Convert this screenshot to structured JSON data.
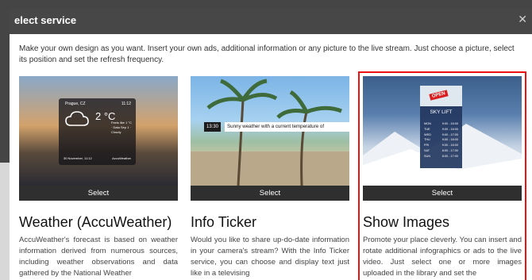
{
  "modal": {
    "title": "elect service",
    "close_icon": "close-icon",
    "intro": "Make your own design as you want. Insert your own ads, additional information or any picture to the live stream. Just choose a picture, select its position and set the refresh frequency."
  },
  "cards": [
    {
      "select_label": "Select",
      "title": "Weather (AccuWeather)",
      "description": "AccuWeather's forecast is based on weather information derived from numerous sources, including weather observations and data gathered by the National Weather",
      "preview": {
        "location": "Prague, CZ",
        "time": "11:12",
        "temperature": "2 °C",
        "details": "Feels like 1 °C · Data Sep 1 · Cloudy",
        "date": "30 November, 11:12",
        "brand": "AccuWeather"
      }
    },
    {
      "select_label": "Select",
      "title": "Info Ticker",
      "description": "Would you like to share up-do-date information in your camera's stream? With the Info Ticker service, you can choose and display text just like in a televising",
      "preview": {
        "ticker_time": "13:30",
        "ticker_text": "Sunny weather with a current temperature of"
      }
    },
    {
      "select_label": "Select",
      "title": "Show Images",
      "description": "Promote your place cleverly. You can insert and rotate additional infographics or ads to the live video. Just select one or more images uploaded in the library and set the",
      "preview": {
        "open_tag": "OPEN",
        "panel_title": "SKY LIFT",
        "rows": [
          {
            "day": "MON",
            "hours": "9:00 - 16:00"
          },
          {
            "day": "TUE",
            "hours": "9:00 - 16:00"
          },
          {
            "day": "WED",
            "hours": "9:00 - 17:00"
          },
          {
            "day": "THU",
            "hours": "9:00 - 16:00"
          },
          {
            "day": "FRI",
            "hours": "9:00 - 16:00"
          },
          {
            "day": "SAT",
            "hours": "8:00 - 17:00"
          },
          {
            "day": "SUN",
            "hours": "8:00 - 17:00"
          }
        ]
      }
    }
  ],
  "colors": {
    "header_bg": "#474747",
    "selected_outline": "#ee1111",
    "select_bar": "#2f2f2f"
  }
}
